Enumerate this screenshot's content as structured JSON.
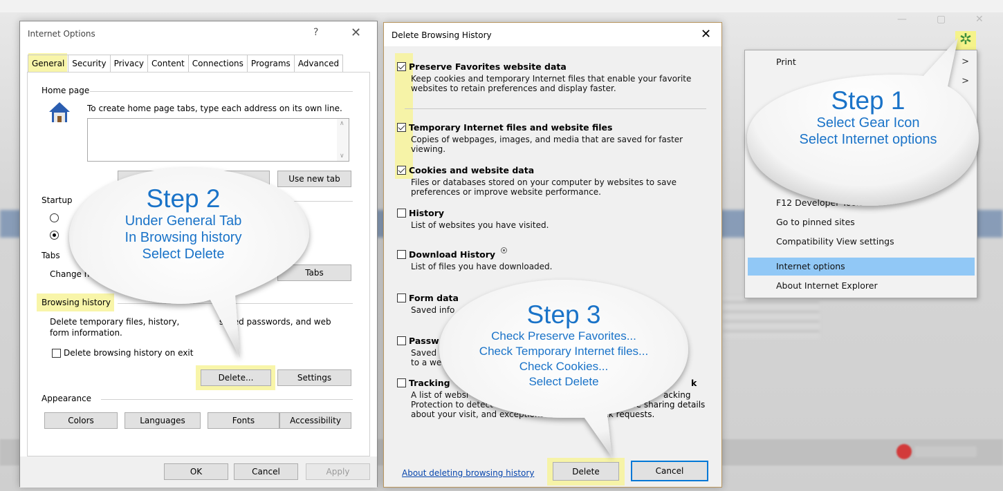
{
  "internet_options": {
    "title": "Internet Options",
    "help": "?",
    "close": "✕",
    "tabs": [
      "General",
      "Security",
      "Privacy",
      "Content",
      "Connections",
      "Programs",
      "Advanced"
    ],
    "home_page": {
      "group_label": "Home page",
      "instruction": "To create home page tabs, type each address on its own line.",
      "use_new_tab": "Use new tab"
    },
    "startup": {
      "group_label": "Startup"
    },
    "tabs_group": {
      "group_label": "Tabs",
      "text": "Change h",
      "button": "Tabs"
    },
    "browsing_history": {
      "group_label": "Browsing history",
      "text_1": "Delete temporary files, history,",
      "text_2": "saved passwords, and web",
      "text_3": "form information.",
      "delete_on_exit": "Delete browsing history on exit",
      "delete_button": "Delete...",
      "settings_button": "Settings"
    },
    "appearance": {
      "group_label": "Appearance",
      "buttons": [
        "Colors",
        "Languages",
        "Fonts",
        "Accessibility"
      ]
    },
    "footer": {
      "ok": "OK",
      "cancel": "Cancel",
      "apply": "Apply"
    }
  },
  "delete_history": {
    "title": "Delete Browsing History",
    "close": "✕",
    "items": [
      {
        "label": "Preserve Favorites website data",
        "checked": true,
        "desc": "Keep cookies and temporary Internet files that enable your favorite websites to retain preferences and display faster."
      },
      {
        "label": "Temporary Internet files and website files",
        "checked": true,
        "desc": "Copies of webpages, images, and media that are saved for faster viewing."
      },
      {
        "label": "Cookies and website data",
        "checked": true,
        "desc": "Files or databases stored on your computer by websites to save preferences or improve website performance."
      },
      {
        "label": "History",
        "checked": false,
        "desc": "List of websites you have visited."
      },
      {
        "label": "Download History",
        "checked": false,
        "desc": "List of files you have downloaded."
      },
      {
        "label": "Form data",
        "checked": false,
        "desc": "Saved info"
      },
      {
        "label": "Passw",
        "checked": false,
        "desc": "Saved",
        "desc_2": "to a we"
      },
      {
        "label": "Tracking",
        "checked": false,
        "label_tail": "k",
        "desc": "A list of websi",
        "desc_r1": "acking",
        "desc_2": "Protection to detect",
        "desc_r2": "be sharing details",
        "desc_3": "about your visit, and exceptions",
        "desc_r3": "rack requests."
      }
    ],
    "about_link": "About deleting browsing history",
    "delete_button": "Delete",
    "cancel_button": "Cancel"
  },
  "ie_menu": {
    "items": [
      {
        "label": "Print",
        "arrow": ">"
      },
      {
        "label": "",
        "arrow": ">"
      },
      {
        "label": "F12 Developer Tools",
        "arrow": ""
      },
      {
        "label": "Go to pinned sites",
        "arrow": ""
      },
      {
        "label": "Compatibility View settings",
        "arrow": ""
      },
      {
        "label": "Internet options",
        "arrow": "",
        "selected": true
      },
      {
        "label": "About Internet Explorer",
        "arrow": ""
      }
    ]
  },
  "callouts": {
    "step1": {
      "title": "Step 1",
      "lines": [
        "Select Gear Icon",
        "Select Internet options"
      ]
    },
    "step2": {
      "title": "Step 2",
      "lines": [
        "Under General Tab",
        "In Browsing history",
        "Select Delete"
      ]
    },
    "step3": {
      "title": "Step 3",
      "lines": [
        "Check Preserve Favorites...",
        "Check Temporary Internet files...",
        "Check Cookies...",
        "Select Delete"
      ]
    }
  },
  "icons": {
    "gear": "gear-icon",
    "house": "house-icon"
  },
  "colors": {
    "callout_text": "#1a73c8",
    "highlight": "#f7f39a",
    "menu_selected": "#91c8f6",
    "link": "#0645ad",
    "primary_border": "#0078d7"
  }
}
